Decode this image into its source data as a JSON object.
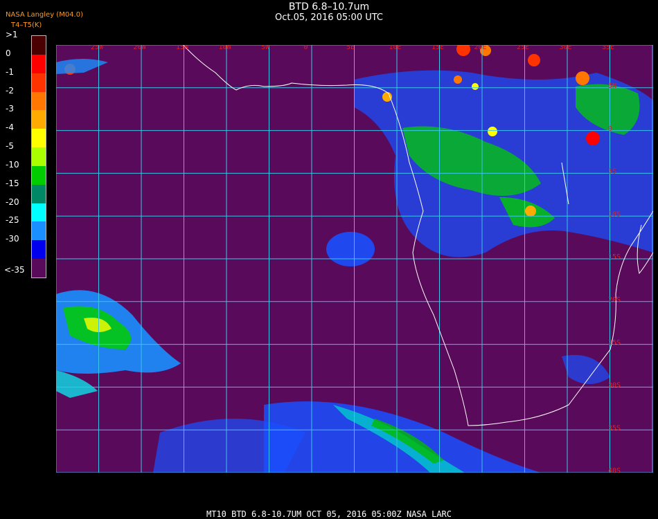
{
  "title_line1": "BTD 6.8–10.7um",
  "title_line2": "Oct.05, 2016 05:00 UTC",
  "credit": "NASA Langley (M04.0)",
  "legend_units": "T4–T5(K)",
  "legend": [
    {
      "label": ">1",
      "color": "#4a0000"
    },
    {
      "label": "0",
      "color": "#ff0000"
    },
    {
      "label": "-1",
      "color": "#ff3300"
    },
    {
      "label": "-2",
      "color": "#ff7700"
    },
    {
      "label": "-3",
      "color": "#ffaa00"
    },
    {
      "label": "-4",
      "color": "#ffff00"
    },
    {
      "label": "-5",
      "color": "#aaff00"
    },
    {
      "label": "-10",
      "color": "#00cc00"
    },
    {
      "label": "-15",
      "color": "#008866"
    },
    {
      "label": "-20",
      "color": "#00ffff"
    },
    {
      "label": "-25",
      "color": "#1a8fff"
    },
    {
      "label": "-30",
      "color": "#0000ee"
    },
    {
      "label": "<-35",
      "color": "#5a0a5a"
    }
  ],
  "lon_labels": [
    "25W",
    "20W",
    "15W",
    "10W",
    "5W",
    "0",
    "5E",
    "10E",
    "15E",
    "20E",
    "25E",
    "30E",
    "35E"
  ],
  "lat_labels": [
    "5N",
    "0",
    "5S",
    "10S",
    "15S",
    "20S",
    "25S",
    "30S",
    "35S",
    "40S"
  ],
  "grid_color": "#39c6e8",
  "background_color": "#5a0a5a",
  "footer": "MT10  BTD 6.8-10.7UM   OCT 05, 2016 05:00Z   NASA LARC"
}
